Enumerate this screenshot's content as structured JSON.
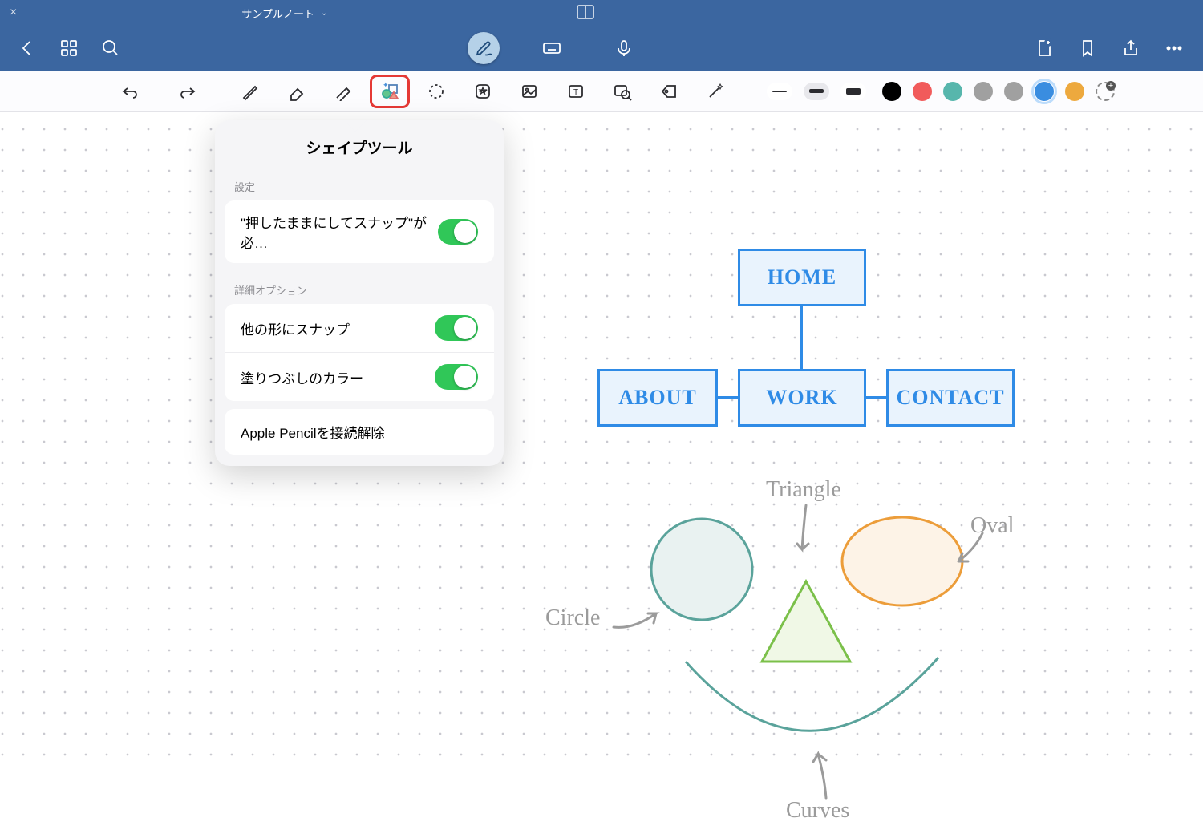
{
  "titleBar": {
    "noteTitle": "サンプルノート"
  },
  "topBar": {
    "icons": [
      "back",
      "grid",
      "search",
      "pen",
      "keyboard",
      "mic",
      "newpage",
      "bookmark",
      "share",
      "more"
    ]
  },
  "toolBar": {
    "colors": [
      {
        "hex": "#000000"
      },
      {
        "hex": "#f15b5b"
      },
      {
        "hex": "#57b6ac"
      },
      {
        "hex": "#a0a0a0"
      },
      {
        "hex": "#a0a0a0"
      },
      {
        "hex": "#3a8de0",
        "selected": true
      },
      {
        "hex": "#eda93e"
      }
    ]
  },
  "popover": {
    "title": "シェイプツール",
    "section1Label": "設定",
    "row1Label": "\"押したままにしてスナップ\"が必…",
    "section2Label": "詳細オプション",
    "row2Label": "他の形にスナップ",
    "row3Label": "塗りつぶしのカラー",
    "disconnectLabel": "Apple Pencilを接続解除"
  },
  "flowchart": {
    "home": "HOME",
    "about": "ABOUT",
    "work": "WORK",
    "contact": "CONTACT"
  },
  "shapes": {
    "triangle": "Triangle",
    "oval": "Oval",
    "circle": "Circle",
    "curves": "Curves"
  }
}
